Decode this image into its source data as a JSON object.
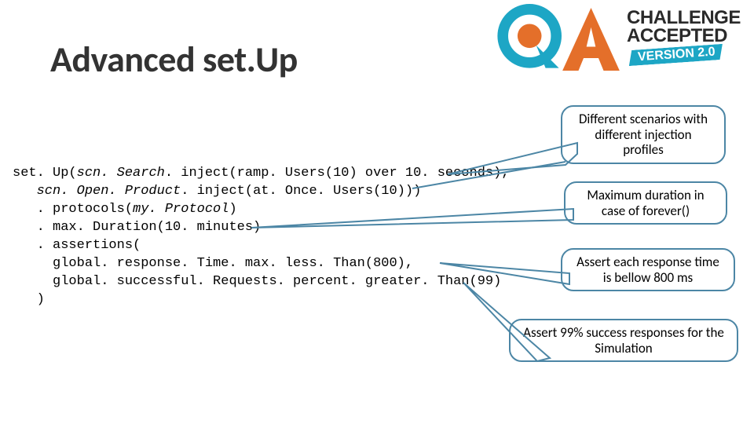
{
  "title": "Advanced set.Up",
  "logo": {
    "challenge": "CHALLENGE",
    "accepted": "ACCEPTED",
    "version": "VERSION 2.0"
  },
  "code": {
    "l1a": "set. Up(",
    "l1b": "scn. Search",
    "l1c": ". inject(ramp. Users(10) over 10. seconds),",
    "l2a": "   ",
    "l2b": "scn. Open. Product",
    "l2c": ". inject(at. Once. Users(10)))",
    "l3a": "   . protocols(",
    "l3b": "my. Protocol",
    "l3c": ")",
    "l4": "   . max. Duration(10. minutes)",
    "l5": "   . assertions(",
    "l6": "     global. response. Time. max. less. Than(800),",
    "l7": "     global. successful. Requests. percent. greater. Than(99)",
    "l8": "   )"
  },
  "callouts": {
    "c1": "Different scenarios\nwith different\ninjection profiles",
    "c2": "Maximum duration\nin case of forever()",
    "c3": "Assert each response\ntime is bellow 800 ms",
    "c4": "Assert 99% success\nresponses for the Simulation"
  }
}
